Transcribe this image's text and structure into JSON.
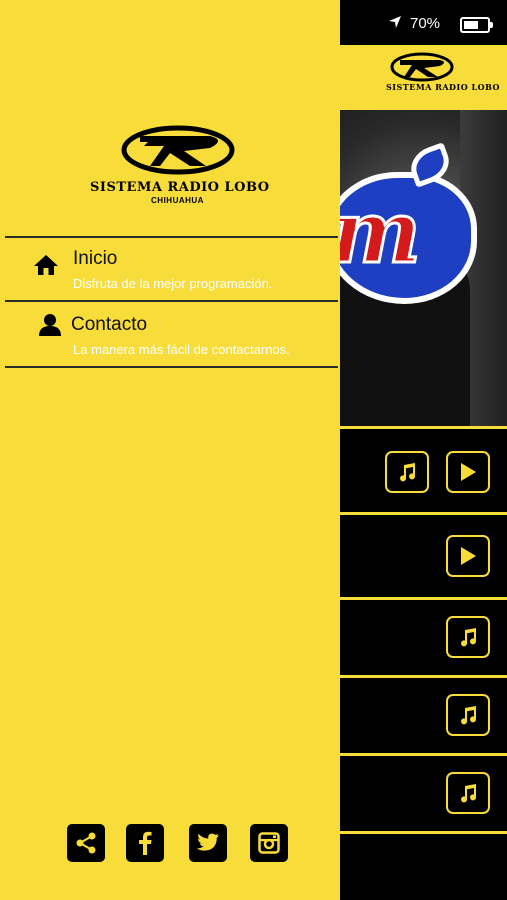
{
  "status_bar": {
    "battery": "70%",
    "battery_level": 0.7
  },
  "brand": {
    "name": "SISTEMA RADIO LOBO",
    "city": "CHIHUAHUA"
  },
  "menu": [
    {
      "title": "Inicio",
      "subtitle": "Disfruta de la mejor programación.",
      "icon": "home-icon"
    },
    {
      "title": "Contacto",
      "subtitle": "La manera más fácil de contactarnos.",
      "icon": "user-icon"
    }
  ],
  "social": [
    "share-icon",
    "facebook-icon",
    "twitter-icon",
    "instagram-icon"
  ],
  "station_rows": [
    {
      "buttons": [
        "music-note-icon",
        "play-icon"
      ]
    },
    {
      "buttons": [
        "play-icon"
      ]
    },
    {
      "buttons": [
        "music-note-icon"
      ]
    },
    {
      "buttons": [
        "music-note-icon"
      ]
    },
    {
      "buttons": [
        "music-note-icon"
      ]
    }
  ],
  "colors": {
    "accent": "#f7dc3a",
    "background": "#000000",
    "subtitle": "#ffffff"
  }
}
